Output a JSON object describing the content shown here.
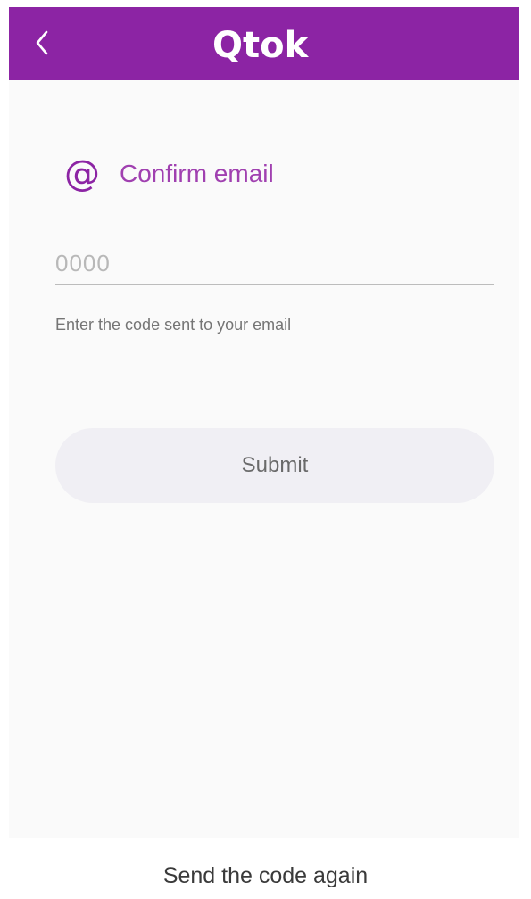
{
  "header": {
    "back_icon": "chevron-left-icon",
    "logo_text": "Qtok",
    "background_color": "#8c24a4"
  },
  "form": {
    "title_icon_glyph": "@",
    "title": "Confirm email",
    "code_input": {
      "placeholder": "0000",
      "value": ""
    },
    "hint": "Enter the code sent to your email",
    "submit_label": "Submit"
  },
  "footer": {
    "resend_label": "Send the code again"
  },
  "colors": {
    "accent": "#8c24a4",
    "button_bg": "#f0eff4"
  }
}
